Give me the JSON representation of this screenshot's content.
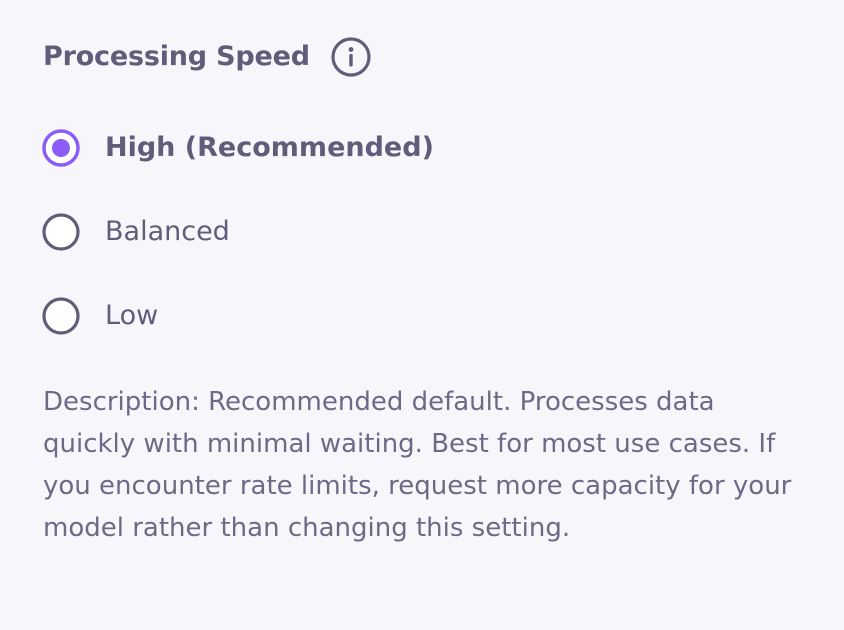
{
  "section": {
    "title": "Processing Speed",
    "info_icon": "info-icon"
  },
  "options": [
    {
      "label": "High (Recommended)",
      "selected": true
    },
    {
      "label": "Balanced",
      "selected": false
    },
    {
      "label": "Low",
      "selected": false
    }
  ],
  "description": "Description: Recommended default. Processes data quickly with minimal waiting. Best for most use cases. If you encounter rate limits, request more capacity for your model rather than changing this setting.",
  "colors": {
    "accent": "#8b5cf6",
    "text": "#5f5d79",
    "radio_border": "#5f5d79",
    "background": "#f7f7fb"
  }
}
